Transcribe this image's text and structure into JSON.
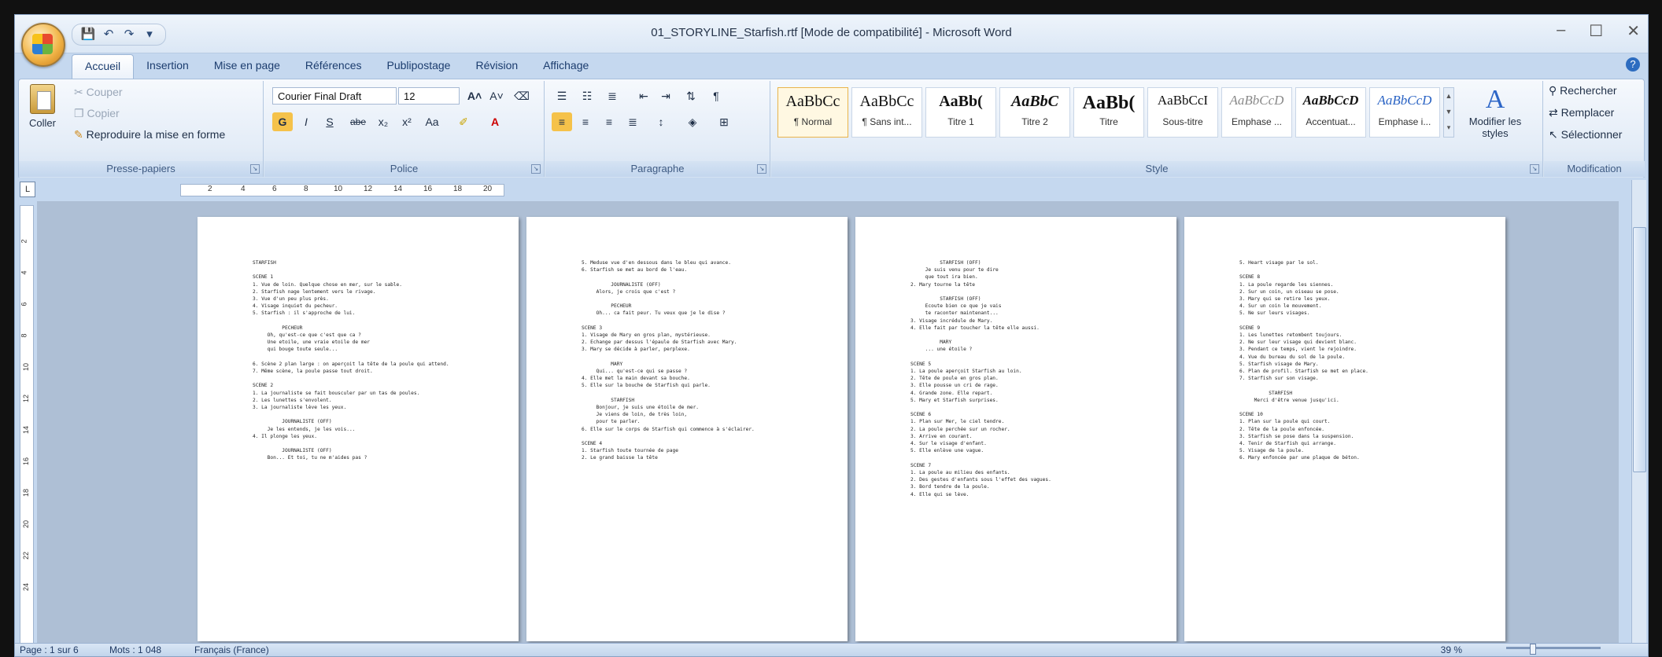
{
  "window": {
    "title": "01_STORYLINE_Starfish.rtf [Mode de compatibilité] - Microsoft Word",
    "controls": [
      "–",
      "☐",
      "✕"
    ]
  },
  "qat": {
    "icons": [
      "save-icon",
      "undo-icon",
      "redo-icon",
      "customize-icon"
    ]
  },
  "tabs": [
    "Accueil",
    "Insertion",
    "Mise en page",
    "Références",
    "Publipostage",
    "Révision",
    "Affichage"
  ],
  "active_tab": "Accueil",
  "clipboard": {
    "label": "Presse-papiers",
    "paste": "Coller",
    "cut": "Couper",
    "copy": "Copier",
    "format_painter": "Reproduire la mise en forme"
  },
  "font": {
    "label": "Police",
    "family": "Courier Final Draft",
    "size": "12",
    "buttons": [
      "G",
      "I",
      "S",
      "abe",
      "x₂",
      "x²",
      "Aa"
    ]
  },
  "paragraph": {
    "label": "Paragraphe"
  },
  "styles": {
    "label": "Style",
    "items": [
      {
        "preview": "AaBbCc",
        "name": "¶ Normal"
      },
      {
        "preview": "AaBbCc",
        "name": "¶ Sans int..."
      },
      {
        "preview": "AaBb(",
        "name": "Titre 1"
      },
      {
        "preview": "AaBbC",
        "name": "Titre 2"
      },
      {
        "preview": "AaBb(",
        "name": "Titre"
      },
      {
        "preview": "AaBbCcI",
        "name": "Sous-titre"
      },
      {
        "preview": "AaBbCcD",
        "name": "Emphase ..."
      },
      {
        "preview": "AaBbCcD",
        "name": "Accentuat..."
      },
      {
        "preview": "AaBbCcD",
        "name": "Emphase i..."
      }
    ],
    "modify": "Modifier les styles"
  },
  "editing": {
    "label": "Modification",
    "find": "Rechercher",
    "replace": "Remplacer",
    "select": "Sélectionner"
  },
  "ruler": {
    "ticks": [
      "2",
      "4",
      "6",
      "8",
      "10",
      "12",
      "14",
      "16",
      "18",
      "20"
    ]
  },
  "vruler": {
    "ticks": [
      "2",
      "4",
      "6",
      "8",
      "10",
      "12",
      "14",
      "16",
      "18",
      "20",
      "22",
      "24"
    ]
  },
  "pages": [
    "STARFISH\n\nSCENE 1\n1. Vue de loin. Quelque chose en mer, sur le sable.\n2. Starfish nage lentement vers le rivage.\n3. Vue d'un peu plus près.\n4. Visage inquiet du pecheur.\n5. Starfish : il s'approche de lui.\n\n          PECHEUR\n     Oh, qu'est-ce que c'est que ca ?\n     Une etoile, une vraie etoile de mer\n     qui bouge toute seule...\n\n6. Scène 2 plan large : on aperçoit la tête de la poule qui attend.\n7. Même scène, la poule passe tout droit.\n\nSCENE 2\n1. La journaliste se fait bousculer par un tas de poules.\n2. Les lunettes s'envolent.\n3. La journaliste lève les yeux.\n\n          JOURNALISTE (OFF)\n     Je les entends, je les vois...\n4. Il plonge les yeux.\n\n          JOURNALISTE (OFF)\n     Bon... Et toi, tu ne m'aides pas ?",
    "5. Meduse vue d'en dessous dans le bleu qui avance.\n6. Starfish se met au bord de l'eau.\n\n          JOURNALISTE (OFF)\n     Alors, je crois que c'est ?\n\n          PECHEUR\n     Oh... ca fait peur. Tu veux que je le dise ?\n\nSCENE 3\n1. Visage de Mary en gros plan, mystérieuse.\n2. Echange par dessus l'épaule de Starfish avec Mary.\n3. Mary se décide à parler, perplexe.\n\n          MARY\n     Qui... qu'est-ce qui se passe ?\n4. Elle met la main devant sa bouche.\n5. Elle sur la bouche de Starfish qui parle.\n\n          STARFISH\n     Bonjour, je suis une étoile de mer.\n     Je viens de loin, de très loin,\n     pour te parler.\n6. Elle sur le corps de Starfish qui commence à s'éclairer.\n\nSCENE 4\n1. Starfish toute tournée de page\n2. Le grand baisse la tête",
    "          STARFISH (OFF)\n     Je suis venu pour te dire\n     que tout ira bien.\n2. Mary tourne la tête\n\n          STARFISH (OFF)\n     Ecoute bien ce que je vais\n     te raconter maintenant...\n3. Visage incrédule de Mary.\n4. Elle fait par toucher la tête elle aussi.\n\n          MARY\n     ... une étoile ?\n\nSCENE 5\n1. La poule aperçoit Starfish au loin.\n2. Tête de poule en gros plan.\n3. Elle pousse un cri de rage.\n4. Grande zone. Elle repart.\n5. Mary et Starfish surprises.\n\nSCENE 6\n1. Plan sur Mer, le ciel tendre.\n2. La poule perchée sur un rocher.\n3. Arrive en courant.\n4. Sur le visage d'enfant.\n5. Elle enlève une vague.\n\nSCENE 7\n1. La poule au milieu des enfants.\n2. Des gestes d'enfants sous l'effet des vagues.\n3. Bord tendre de la poule.\n4. Elle qui se lève.",
    "5. Heart visage par le sol.\n\nSCENE 8\n1. La poule regarde les siennes.\n2. Sur un coin, un oiseau se pose.\n3. Mary qui se retire les yeux.\n4. Sur un coin le mouvement.\n5. Ne sur leurs visages.\n\nSCENE 9\n1. Les lunettes retombent toujours.\n2. Ne sur leur visage qui devient blanc.\n3. Pendant ce temps, vient le rejoindre.\n4. Vue du bureau du sol de la poule.\n5. Starfish visage de Mary.\n6. Plan de profil. Starfish se met en place.\n7. Starfish sur son visage.\n\n          STARFISH\n     Merci d'être venue jusqu'ici.\n\nSCENE 10\n1. Plan sur la poule qui court.\n2. Tête de la poule enfoncée.\n3. Starfish se pose dans la suspension.\n4. Tenir de Starfish qui arrange.\n5. Visage de la poule.\n6. Mary enfoncée par une plaque de béton."
  ],
  "status": {
    "page": "Page : 1 sur 6",
    "words": "Mots : 1 048",
    "language": "Français (France)",
    "zoom": "39 %"
  }
}
